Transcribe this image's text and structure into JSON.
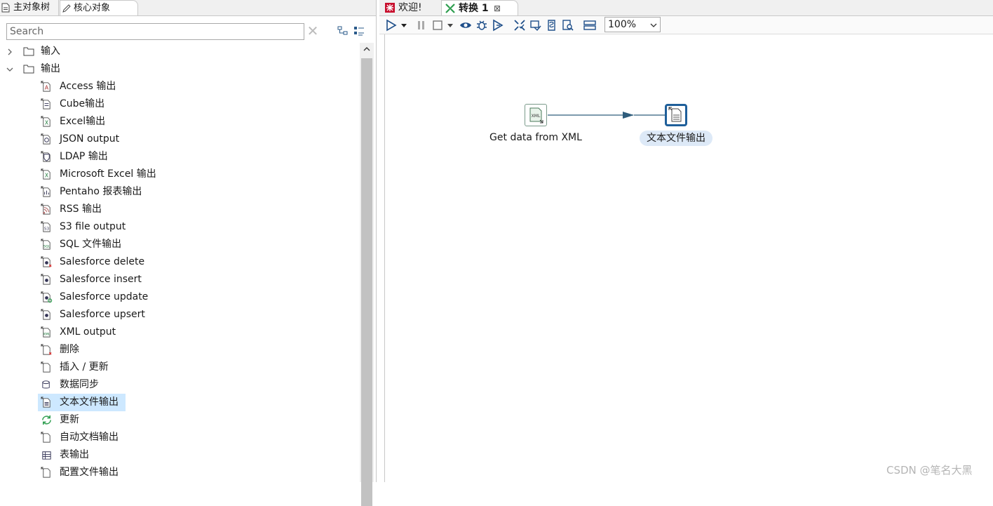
{
  "left_panel": {
    "tabs": [
      {
        "label": "主对象树",
        "icon": "document-icon"
      },
      {
        "label": "核心对象",
        "icon": "pencil-icon"
      }
    ],
    "search": {
      "placeholder": "Search",
      "value": ""
    },
    "tree": {
      "folders": [
        {
          "label": "输入",
          "expanded": false
        },
        {
          "label": "输出",
          "expanded": true
        }
      ],
      "output_items": [
        {
          "label": "Access 输出",
          "icon": "access-icon"
        },
        {
          "label": "Cube输出",
          "icon": "cube-file-icon"
        },
        {
          "label": "Excel输出",
          "icon": "excel-icon"
        },
        {
          "label": "JSON output",
          "icon": "json-icon"
        },
        {
          "label": "LDAP 输出",
          "icon": "ldap-icon"
        },
        {
          "label": "Microsoft Excel 输出",
          "icon": "excel-icon"
        },
        {
          "label": "Pentaho 报表输出",
          "icon": "report-icon"
        },
        {
          "label": "RSS 输出",
          "icon": "rss-icon"
        },
        {
          "label": "S3 file output",
          "icon": "s3-icon"
        },
        {
          "label": "SQL 文件输出",
          "icon": "sql-file-icon"
        },
        {
          "label": "Salesforce delete",
          "icon": "salesforce-delete-icon"
        },
        {
          "label": "Salesforce insert",
          "icon": "salesforce-insert-icon"
        },
        {
          "label": "Salesforce update",
          "icon": "salesforce-update-icon"
        },
        {
          "label": "Salesforce upsert",
          "icon": "salesforce-upsert-icon"
        },
        {
          "label": "XML output",
          "icon": "xml-icon"
        },
        {
          "label": "删除",
          "icon": "delete-table-icon"
        },
        {
          "label": "插入 / 更新",
          "icon": "insert-update-icon"
        },
        {
          "label": "数据同步",
          "icon": "database-sync-icon"
        },
        {
          "label": "文本文件输出",
          "icon": "text-file-icon",
          "selected": true
        },
        {
          "label": "更新",
          "icon": "refresh-icon"
        },
        {
          "label": "自动文档输出",
          "icon": "auto-doc-icon"
        },
        {
          "label": "表输出",
          "icon": "table-output-icon"
        },
        {
          "label": "配置文件输出",
          "icon": "properties-file-icon"
        }
      ]
    }
  },
  "right_panel": {
    "tabs": [
      {
        "label": "欢迎!",
        "icon": "welcome-icon"
      },
      {
        "label": "转换 1",
        "icon": "transformation-icon",
        "active": true,
        "closable": true
      }
    ],
    "toolbar": {
      "zoom": "100%",
      "buttons": [
        "run-icon",
        "run-dropdown-icon",
        "pause-icon",
        "stop-icon",
        "stop-dropdown-icon",
        "preview-icon",
        "debug-icon",
        "replay-icon",
        "verify-icon",
        "impact-icon",
        "sql-icon",
        "explore-db-icon",
        "show-results-icon"
      ]
    },
    "canvas": {
      "nodes": [
        {
          "label": "Get data from XML",
          "icon": "xml-input-icon"
        },
        {
          "label": "文本文件输出",
          "icon": "text-file-output-icon",
          "selected": true
        }
      ],
      "hop": {
        "from": "Get data from XML",
        "to": "文本文件输出"
      }
    }
  },
  "watermark": "CSDN @笔名大黑",
  "colors": {
    "selection": "#cde8ff",
    "node_selected_border": "#1f5f9a",
    "hop_line": "#2f5d7c",
    "welcome_red": "#c8102e",
    "transformation_green": "#2e9e4f",
    "toolbar_blue": "#1f4f8a"
  }
}
